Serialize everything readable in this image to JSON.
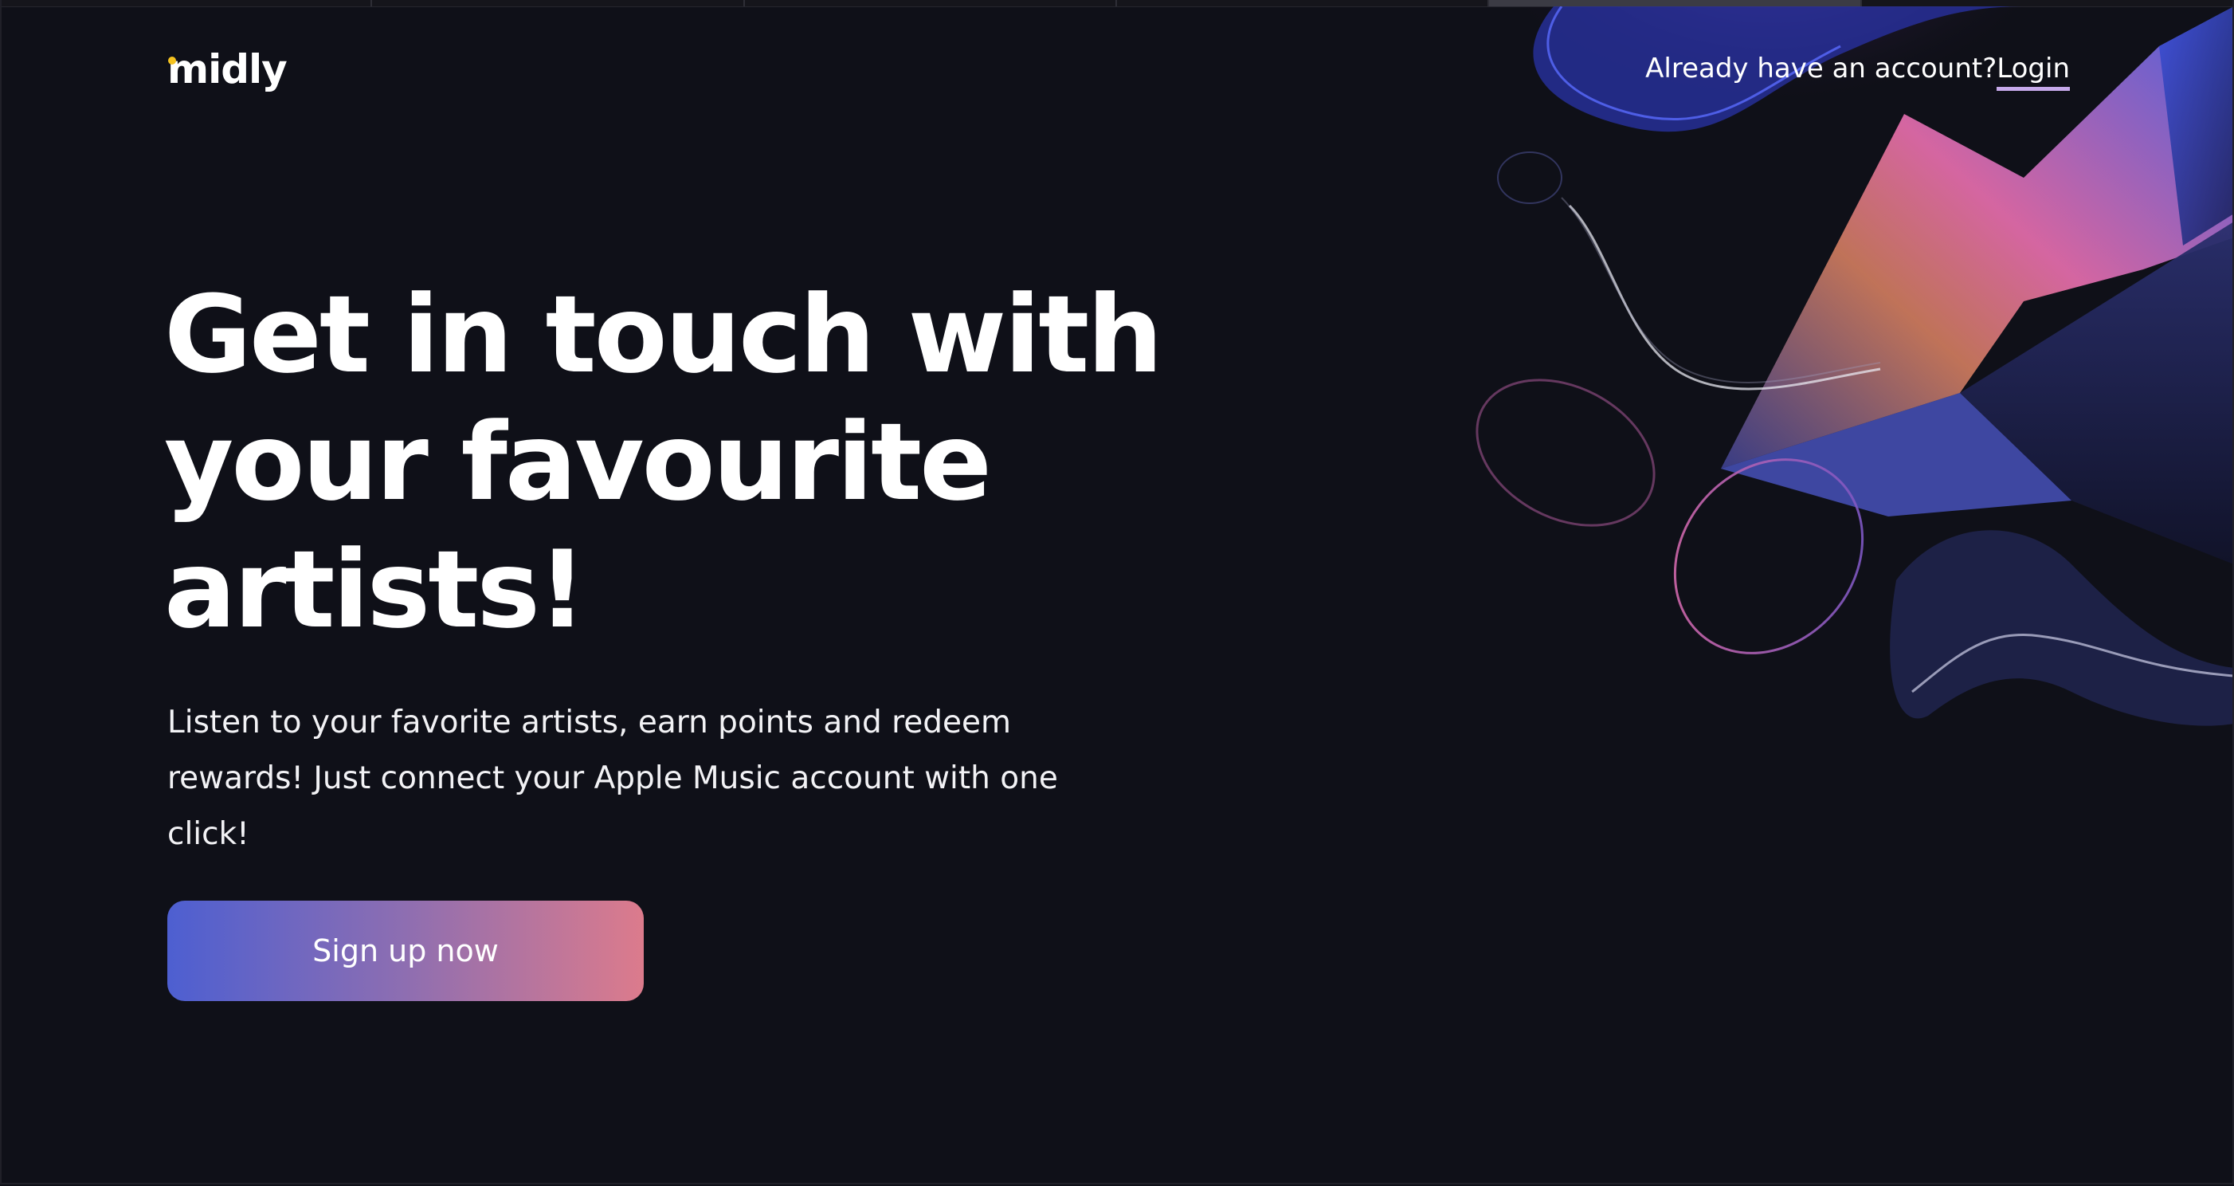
{
  "brand": {
    "name": "midly",
    "dot_color": "#f4c21f"
  },
  "header": {
    "prompt": "Already have an account?",
    "login_label": "Login"
  },
  "hero": {
    "title_lines": [
      "Get in touch with",
      "your favourite",
      "artists!"
    ],
    "subtitle": "Listen to your favorite artists, earn points and redeem rewards! Just connect your Apple Music account with one click!",
    "cta_label": "Sign up now"
  },
  "colors": {
    "background": "#0f1018",
    "cta_gradient_start": "#4d5fd1",
    "cta_gradient_end": "#dc7b8c",
    "login_underline": "#c6a9ea"
  }
}
